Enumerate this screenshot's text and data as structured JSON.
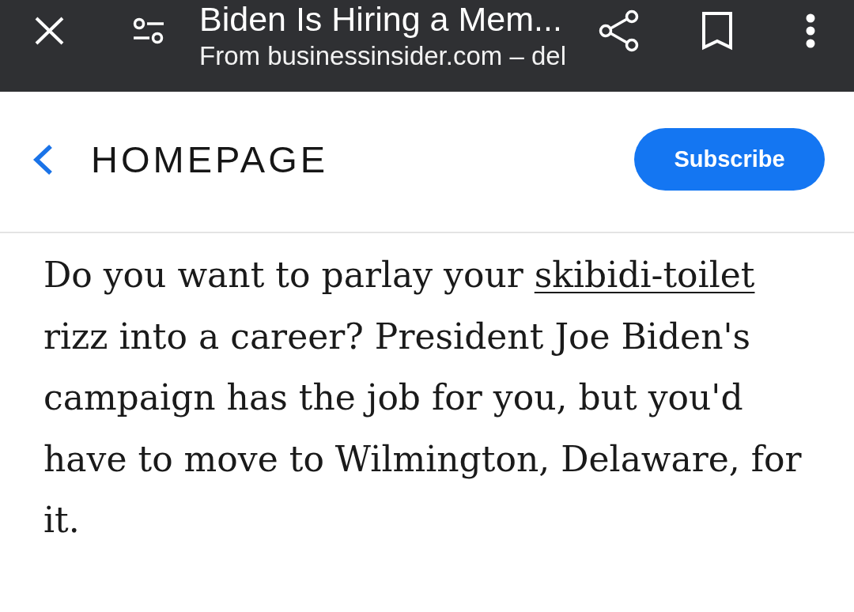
{
  "toolbar": {
    "title": "Biden Is Hiring a Mem...",
    "subtitle": "From businessinsider.com – del"
  },
  "header": {
    "back_label": "HOMEPAGE",
    "subscribe_label": "Subscribe"
  },
  "article": {
    "paragraph": [
      {
        "kind": "text",
        "text": "Do you want to parlay your "
      },
      {
        "kind": "link",
        "text": "skibidi-toilet"
      },
      {
        "kind": "text",
        "text": " rizz into a career? President Joe Biden's campaign has the job for you, but you'd have to move to Wilmington, Delaware, for it."
      }
    ]
  }
}
